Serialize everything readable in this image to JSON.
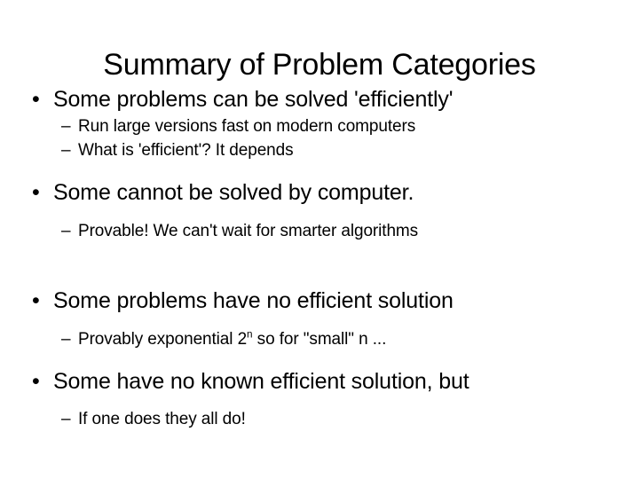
{
  "slide": {
    "title": "Summary of Problem Categories",
    "background_color": "#ffffff",
    "text_color": "#000000",
    "bullet_marker": "•",
    "sub_marker": "–",
    "blocks": [
      {
        "bullet": "Some problems can be solved 'efficiently'",
        "subs": [
          "Run large versions fast on modern computers",
          "What is 'efficient'? It depends"
        ]
      },
      {
        "bullet": "Some cannot be solved by computer.",
        "subs": [
          "Provable! We can't wait for smarter algorithms"
        ]
      },
      {
        "bullet": "Some problems have no efficient solution",
        "subs_rich": [
          {
            "pre": "Provably exponential 2",
            "sup": "n",
            "post": " so for \"small\" n ..."
          }
        ]
      },
      {
        "bullet": "Some have no known efficient solution, but",
        "subs": [
          "If one does they all do!"
        ]
      }
    ]
  }
}
